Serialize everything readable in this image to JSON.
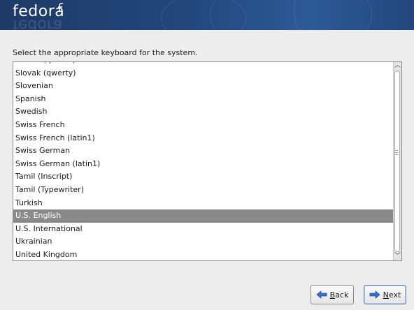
{
  "banner": {
    "logo_text": "fedora"
  },
  "prompt": "Select the appropriate keyboard for the system.",
  "keyboard_list": {
    "items": [
      "Slovak (qwertz)",
      "Slovak (qwerty)",
      "Slovenian",
      "Spanish",
      "Swedish",
      "Swiss French",
      "Swiss French (latin1)",
      "Swiss German",
      "Swiss German (latin1)",
      "Tamil (Inscript)",
      "Tamil (Typewriter)",
      "Turkish",
      "U.S. English",
      "U.S. International",
      "Ukrainian",
      "United Kingdom"
    ],
    "selected": "U.S. English"
  },
  "buttons": {
    "back": {
      "mnemonic": "B",
      "rest": "ack"
    },
    "next": {
      "mnemonic": "N",
      "rest": "ext"
    }
  },
  "colors": {
    "banner": "#23477c",
    "selection": "#8a8a8a",
    "arrow_icon": "#3a6fc4"
  },
  "icons": {
    "back": "left-arrow-icon",
    "next": "right-arrow-icon",
    "scroll_up": "chevron-up-icon",
    "scroll_down": "chevron-down-icon"
  }
}
